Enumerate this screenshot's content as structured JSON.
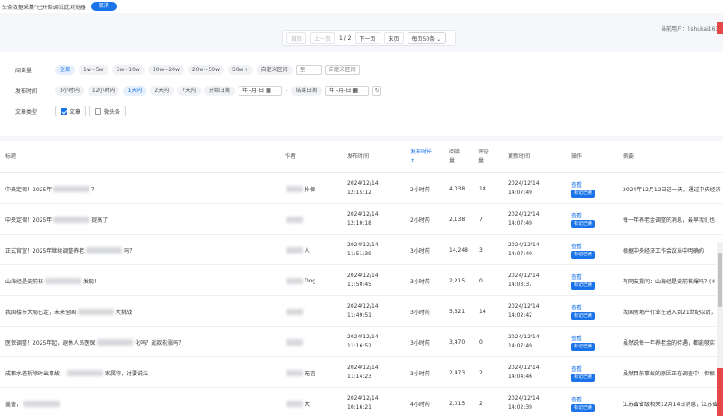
{
  "topbar": {
    "notice": "头条数据采集\"已开始调试此浏览器",
    "cancel": "取消"
  },
  "pager": {
    "first": "首页",
    "prev": "上一页",
    "page": "1 / 2",
    "next": "下一页",
    "last": "末页",
    "per_page": "每页50条"
  },
  "user": {
    "label": "当前用户：lishukai163"
  },
  "filters": {
    "reads": {
      "label": "阅读量",
      "options": [
        "全部",
        "1w~5w",
        "5w~10w",
        "10w~20w",
        "20w~50w",
        "50w+",
        "自定义区间"
      ],
      "sep": "至",
      "custom_placeholder": "自定义区间"
    },
    "time": {
      "label": "发布时间",
      "options": [
        "3小时内",
        "12小时内",
        "1天内",
        "2天内",
        "7天内",
        "开始日期"
      ],
      "date_start": "年 -月-日",
      "dash": "-",
      "end_label": "结束日期",
      "date_end": "年 -月-日"
    },
    "type": {
      "label": "文章类型",
      "article": "文章",
      "weitoutiao": "微头条"
    }
  },
  "table": {
    "headers": [
      "标题",
      "作者",
      "发布时间",
      "发布时长",
      "阅读量",
      "评论量",
      "更新时间",
      "操作",
      "摘要"
    ],
    "sort_marker": "↕",
    "view_label": "查看",
    "mark_label": "标记已读",
    "rows": [
      {
        "title_a": "中央定调！2025年",
        "title_b": "？",
        "author": "扑保",
        "pub_date": "2024/12/14",
        "pub_time": "12:15:12",
        "ago": "2小时前",
        "reads": "4,038",
        "comments": "18",
        "upd_date": "2024/12/14",
        "upd_time": "14:07:49",
        "summary": "2024年12月12日这一天，通过中央经济"
      },
      {
        "title_a": "中央定调！2025年",
        "title_b": "提高了",
        "author": "",
        "pub_date": "2024/12/14",
        "pub_time": "12:10:18",
        "ago": "2小时前",
        "reads": "2,138",
        "comments": "7",
        "upd_date": "2024/12/14",
        "upd_time": "14:07:49",
        "summary": "每一年养老金调整的消息，最早我们也"
      },
      {
        "title_a": "正式官宣！2025年继续调整养老",
        "title_b": "吗？",
        "author": "人",
        "pub_date": "2024/12/14",
        "pub_time": "11:51:39",
        "ago": "3小时前",
        "reads": "14,248",
        "comments": "3",
        "upd_date": "2024/12/14",
        "upd_time": "14:07:49",
        "summary": "根据中央经济工作会议当中明确的"
      },
      {
        "title_a": "山海经是史前核",
        "title_b": "发现！",
        "author": "Dog",
        "pub_date": "2024/12/14",
        "pub_time": "11:50:45",
        "ago": "3小时前",
        "reads": "2,215",
        "comments": "0",
        "upd_date": "2024/12/14",
        "upd_time": "14:03:37",
        "summary": "有网友提问：山海经是史前核爆吗？(4"
      },
      {
        "title_a": "我国楼市大局已定，未来全国",
        "title_b": "大挑战",
        "author": "",
        "pub_date": "2024/12/14",
        "pub_time": "11:49:51",
        "ago": "3小时前",
        "reads": "5,621",
        "comments": "14",
        "upd_date": "2024/12/14",
        "upd_time": "14:02:42",
        "summary": "我国房地产行业在进入到21世纪以后，"
      },
      {
        "title_a": "医保调整！2025年起，退休人员医保",
        "title_b": "化吗？返款能涨吗？",
        "author": "",
        "pub_date": "2024/12/14",
        "pub_time": "11:16:52",
        "ago": "3小时前",
        "reads": "3,470",
        "comments": "0",
        "upd_date": "2024/12/14",
        "upd_time": "14:07:49",
        "summary": "虽然说每一年养老金的待遇，都能够实"
      },
      {
        "title_a": "成都水塔拆除时出事故，",
        "title_b": "家属称，讨要说法",
        "author": "无言",
        "pub_date": "2024/12/14",
        "pub_time": "11:14:23",
        "ago": "3小时前",
        "reads": "2,473",
        "comments": "2",
        "upd_date": "2024/12/14",
        "upd_time": "14:04:46",
        "summary": "虽然目前事故的原因正在调查中，但根"
      },
      {
        "title_a": "盖蕾，",
        "title_b": "",
        "author": "大",
        "pub_date": "2024/12/14",
        "pub_time": "10:16:21",
        "ago": "4小时前",
        "reads": "2,015",
        "comments": "2",
        "upd_date": "2024/12/14",
        "upd_time": "14:02:39",
        "summary": "江苏省省级相关12月14日消息，江苏省"
      }
    ]
  }
}
